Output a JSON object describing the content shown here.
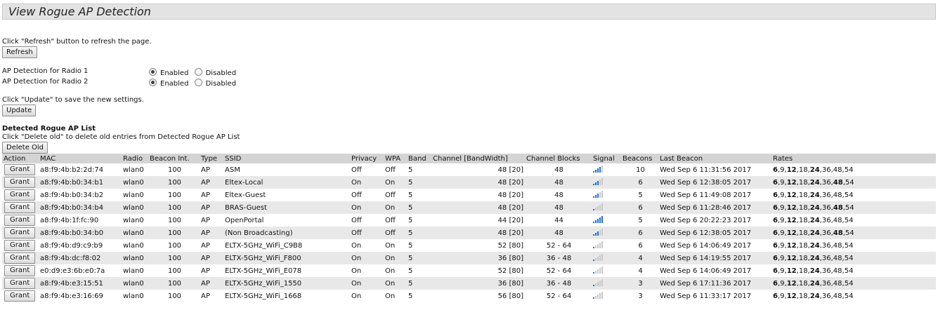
{
  "title": "View Rogue AP Detection",
  "refresh": {
    "hint": "Click \"Refresh\" button to refresh the page.",
    "button": "Refresh"
  },
  "radios": [
    {
      "label": "AP Detection for Radio 1",
      "enabled": "Enabled",
      "disabled": "Disabled",
      "selected": "enabled"
    },
    {
      "label": "AP Detection for Radio 2",
      "enabled": "Enabled",
      "disabled": "Disabled",
      "selected": "enabled"
    }
  ],
  "update": {
    "hint": "Click \"Update\" to save the new settings.",
    "button": "Update"
  },
  "list": {
    "heading": "Detected Rogue AP List",
    "hint": "Click \"Delete old\" to delete old entries from Detected Rogue AP List",
    "delete_button": "Delete Old",
    "grant_label": "Grant",
    "columns": [
      "Action",
      "MAC",
      "Radio",
      "Beacon Int.",
      "Type",
      "SSID",
      "Privacy",
      "WPA",
      "Band",
      "Channel [BandWidth]",
      "Channel Blocks",
      "Signal",
      "Beacons",
      "Last Beacon",
      "Rates"
    ],
    "signal_colors": {
      "active": "#1f6fd6",
      "inactive": "#c9c9c9"
    },
    "rows": [
      {
        "mac": "a8:f9:4b:b2:2d:74",
        "radio": "wlan0",
        "beacon_int": "100",
        "type": "AP",
        "ssid": "ASM",
        "privacy": "Off",
        "wpa": "Off",
        "band": "5",
        "channel": "48 [20]",
        "blocks": "48",
        "signal": 4,
        "beacons": "10",
        "last": "Wed Sep 6 11:31:56 2017",
        "rates": "6,9,12,18,24,36,48,54",
        "bold_rates": [
          "6",
          "12",
          "24"
        ]
      },
      {
        "mac": "a8:f9:4b:b0:34:b1",
        "radio": "wlan0",
        "beacon_int": "100",
        "type": "AP",
        "ssid": "Eltex-Local",
        "privacy": "On",
        "wpa": "On",
        "band": "5",
        "channel": "48 [20]",
        "blocks": "48",
        "signal": 3,
        "beacons": "6",
        "last": "Wed Sep 6 12:38:05 2017",
        "rates": "6,9,12,18,24,36,48,54",
        "bold_rates": [
          "6",
          "12",
          "24",
          "48"
        ]
      },
      {
        "mac": "a8:f9:4b:b0:34:b2",
        "radio": "wlan0",
        "beacon_int": "100",
        "type": "AP",
        "ssid": "Eltex-Guest",
        "privacy": "Off",
        "wpa": "Off",
        "band": "5",
        "channel": "48 [20]",
        "blocks": "48",
        "signal": 3,
        "beacons": "5",
        "last": "Wed Sep 6 11:49:08 2017",
        "rates": "6,9,12,18,24,36,48,54",
        "bold_rates": [
          "6",
          "12",
          "24"
        ]
      },
      {
        "mac": "a8:f9:4b:b0:34:b4",
        "radio": "wlan0",
        "beacon_int": "100",
        "type": "AP",
        "ssid": "BRAS-Guest",
        "privacy": "On",
        "wpa": "On",
        "band": "5",
        "channel": "48 [20]",
        "blocks": "48",
        "signal": 1,
        "beacons": "6",
        "last": "Wed Sep 6 11:28:46 2017",
        "rates": "6,9,12,18,24,36,48,54",
        "bold_rates": [
          "6",
          "12",
          "24",
          "48"
        ]
      },
      {
        "mac": "a8:f9:4b:1f:fc:90",
        "radio": "wlan0",
        "beacon_int": "100",
        "type": "AP",
        "ssid": "OpenPortal",
        "privacy": "Off",
        "wpa": "Off",
        "band": "5",
        "channel": "44 [20]",
        "blocks": "44",
        "signal": 5,
        "beacons": "5",
        "last": "Wed Sep 6 20:22:23 2017",
        "rates": "6,9,12,18,24,36,48,54",
        "bold_rates": [
          "6",
          "12",
          "24"
        ]
      },
      {
        "mac": "a8:f9:4b:b0:34:b0",
        "radio": "wlan0",
        "beacon_int": "100",
        "type": "AP",
        "ssid": "(Non Broadcasting)",
        "privacy": "Off",
        "wpa": "Off",
        "band": "5",
        "channel": "48 [20]",
        "blocks": "48",
        "signal": 3,
        "beacons": "6",
        "last": "Wed Sep 6 12:38:05 2017",
        "rates": "6,9,12,18,24,36,48,54",
        "bold_rates": [
          "6",
          "12",
          "24",
          "48"
        ]
      },
      {
        "mac": "a8:f9:4b:d9:c9:b9",
        "radio": "wlan0",
        "beacon_int": "100",
        "type": "AP",
        "ssid": "ELTX-5GHz_WiFi_C9B8",
        "privacy": "On",
        "wpa": "On",
        "band": "5",
        "channel": "52 [80]",
        "blocks": "52 - 64",
        "signal": 1,
        "beacons": "6",
        "last": "Wed Sep 6 14:06:49 2017",
        "rates": "6,9,12,18,24,36,48,54",
        "bold_rates": [
          "6",
          "12",
          "24"
        ]
      },
      {
        "mac": "a8:f9:4b:dc:f8:02",
        "radio": "wlan0",
        "beacon_int": "100",
        "type": "AP",
        "ssid": "ELTX-5GHz_WiFi_F800",
        "privacy": "On",
        "wpa": "On",
        "band": "5",
        "channel": "36 [80]",
        "blocks": "36 - 48",
        "signal": 1,
        "beacons": "4",
        "last": "Wed Sep 6 14:19:55 2017",
        "rates": "6,9,12,18,24,36,48,54",
        "bold_rates": [
          "6",
          "12",
          "24"
        ]
      },
      {
        "mac": "e0:d9:e3:6b:e0:7a",
        "radio": "wlan0",
        "beacon_int": "100",
        "type": "AP",
        "ssid": "ELTX-5GHz_WiFi_E078",
        "privacy": "On",
        "wpa": "On",
        "band": "5",
        "channel": "52 [80]",
        "blocks": "52 - 64",
        "signal": 1,
        "beacons": "4",
        "last": "Wed Sep 6 14:06:49 2017",
        "rates": "6,9,12,18,24,36,48,54",
        "bold_rates": [
          "6",
          "12",
          "24"
        ]
      },
      {
        "mac": "a8:f9:4b:e3:15:51",
        "radio": "wlan0",
        "beacon_int": "100",
        "type": "AP",
        "ssid": "ELTX-5GHz_WiFi_1550",
        "privacy": "On",
        "wpa": "On",
        "band": "5",
        "channel": "36 [80]",
        "blocks": "36 - 48",
        "signal": 1,
        "beacons": "3",
        "last": "Wed Sep 6 17:11:36 2017",
        "rates": "6,9,12,18,24,36,48,54",
        "bold_rates": [
          "6",
          "12",
          "24"
        ]
      },
      {
        "mac": "a8:f9:4b:e3:16:69",
        "radio": "wlan0",
        "beacon_int": "100",
        "type": "AP",
        "ssid": "ELTX-5GHz_WiFi_1668",
        "privacy": "On",
        "wpa": "On",
        "band": "5",
        "channel": "56 [80]",
        "blocks": "52 - 64",
        "signal": 1,
        "beacons": "3",
        "last": "Wed Sep 6 11:33:17 2017",
        "rates": "6,9,12,18,24,36,48,54",
        "bold_rates": [
          "6",
          "12",
          "24"
        ]
      }
    ]
  }
}
